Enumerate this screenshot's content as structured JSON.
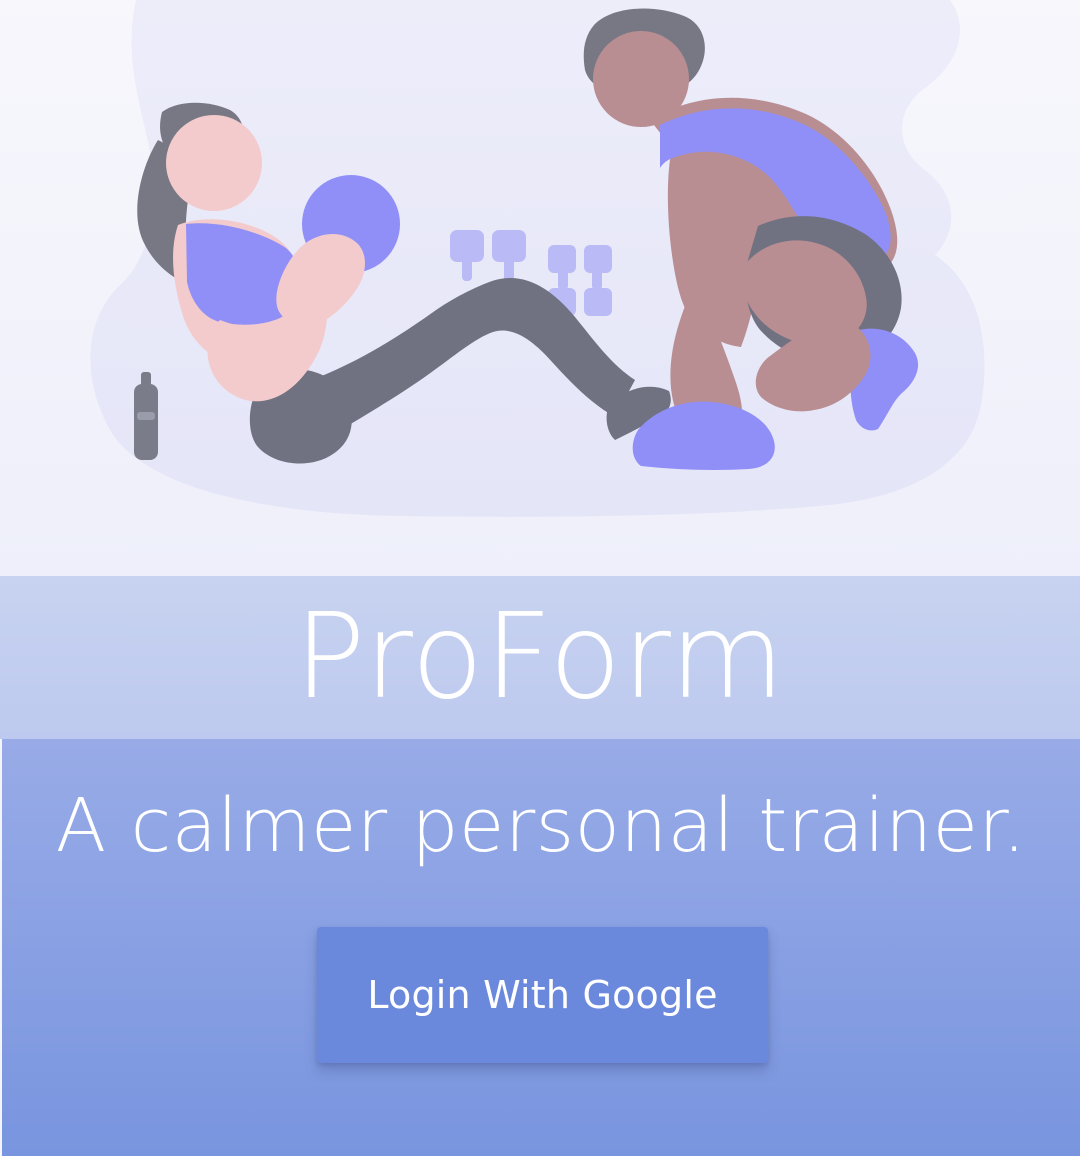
{
  "brand": {
    "title": "ProForm"
  },
  "tagline": {
    "text": "A calmer personal trainer."
  },
  "actions": {
    "login_label": "Login With Google"
  },
  "colors": {
    "hero_background": "#f4f5fb",
    "brand_band": "#c3cef0",
    "content_band": "#8aa2e4",
    "button": "#6b89dc",
    "text": "#ffffff",
    "accent": "#8f8ff7",
    "skin_woman": "#f3cbcd",
    "skin_man": "#b88e93",
    "clothing_dark": "#707181"
  },
  "icons": {
    "hero_illustration": "fitness-illustration-icon",
    "dumbbells": "dumbbell-icon",
    "bottle": "water-bottle-icon",
    "medicine_ball": "medicine-ball-icon"
  }
}
